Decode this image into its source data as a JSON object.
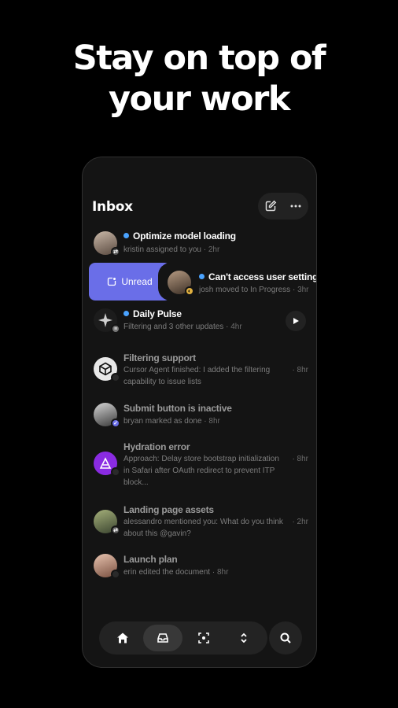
{
  "headline": {
    "line1": "Stay on top of",
    "line2": "your work"
  },
  "inbox": {
    "title": "Inbox"
  },
  "swipe_action": {
    "label": "Unread"
  },
  "items": [
    {
      "title": "Optimize model loading",
      "subtitle": "kristin assigned to you",
      "time": "2hr",
      "unread": true
    },
    {
      "title": "Can't access user settings",
      "subtitle": "josh moved to In Progress",
      "time": "3hr",
      "unread": true
    },
    {
      "title": "Daily Pulse",
      "subtitle": "Filtering and 3 other updates",
      "time": "4hr",
      "unread": true
    },
    {
      "title": "Filtering support",
      "subtitle_line1": "Cursor Agent finished: I added the filtering",
      "subtitle_line2": "capability to issue lists",
      "time": "8hr",
      "unread": false
    },
    {
      "title": "Submit button is inactive",
      "subtitle": "bryan marked as done",
      "time": "8hr",
      "unread": false
    },
    {
      "title": "Hydration error",
      "subtitle_line1": "Approach: Delay store bootstrap initialization",
      "subtitle_line2": "in Safari after OAuth redirect to prevent ITP",
      "subtitle_line3": "block...",
      "time": "8hr",
      "unread": false
    },
    {
      "title": "Landing page assets",
      "subtitle_line1": "alessandro mentioned you: What do you think",
      "subtitle_line2": "about this @gavin?",
      "time": "2hr",
      "unread": false
    },
    {
      "title": "Launch plan",
      "subtitle": "erin edited the document",
      "time": "8hr",
      "unread": false
    }
  ],
  "tabs": [
    {
      "name": "home-icon",
      "active": false
    },
    {
      "name": "inbox-icon",
      "active": true
    },
    {
      "name": "scan-icon",
      "active": false
    },
    {
      "name": "chevron-up-down-icon",
      "active": false
    }
  ],
  "colors": {
    "accent": "#6a6ee8",
    "unread_dot": "#4aa3ff",
    "background": "#000000",
    "panel": "#141414"
  }
}
